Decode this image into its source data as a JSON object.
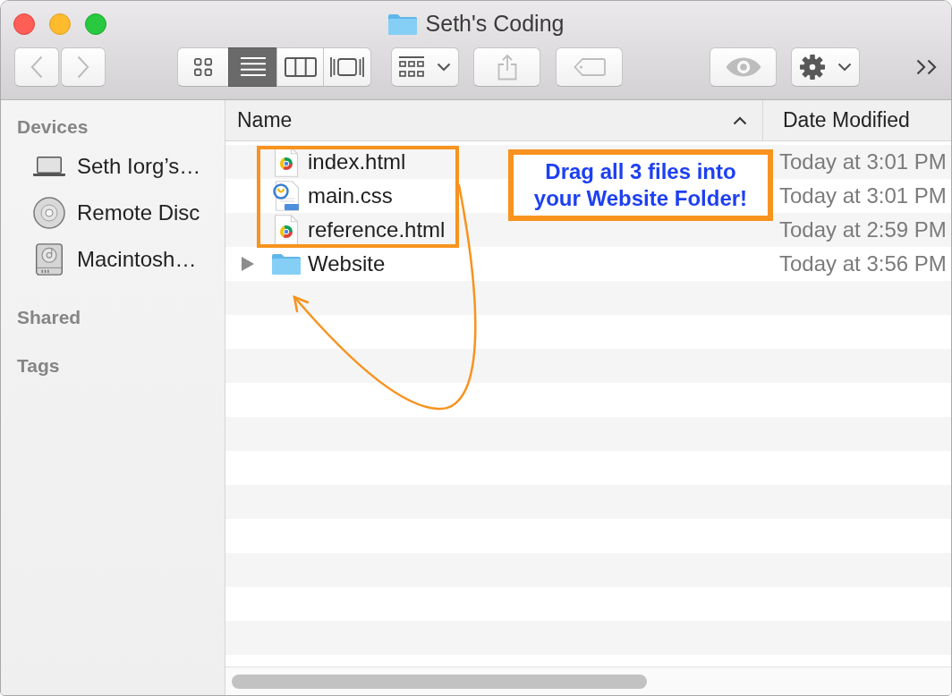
{
  "window": {
    "title": "Seth's Coding"
  },
  "toolbar": {
    "navigation": [
      {
        "kind": "back",
        "disabled": true
      },
      {
        "kind": "forward",
        "disabled": true
      }
    ],
    "view_modes": [
      {
        "kind": "icons",
        "selected": false
      },
      {
        "kind": "list",
        "selected": true
      },
      {
        "kind": "columns",
        "selected": false
      },
      {
        "kind": "gallery",
        "selected": false
      }
    ],
    "actions": [
      {
        "kind": "arrange",
        "disabled": false
      },
      {
        "kind": "share",
        "disabled": true
      },
      {
        "kind": "tags",
        "disabled": true
      },
      {
        "kind": "quick-look",
        "disabled": true
      },
      {
        "kind": "action-menu",
        "disabled": false
      }
    ]
  },
  "sidebar": {
    "sections": [
      {
        "title": "Devices",
        "items": [
          {
            "kind": "laptop",
            "label": "Seth Iorg’s…"
          },
          {
            "kind": "disc",
            "label": "Remote Disc"
          },
          {
            "kind": "drive",
            "label": "Macintosh…"
          }
        ]
      },
      {
        "title": "Shared"
      },
      {
        "title": "Tags"
      }
    ]
  },
  "file_list": {
    "columns": [
      {
        "label": "Name",
        "sorted": true
      },
      {
        "label": "Date Modified",
        "sorted": false
      }
    ],
    "rows": [
      {
        "kind": "web-page",
        "name": "index.html",
        "modified": "Today at 3:01 PM"
      },
      {
        "kind": "stylesheet",
        "name": "main.css",
        "modified": "Today at 3:01 PM"
      },
      {
        "kind": "web-page",
        "name": "reference.html",
        "modified": "Today at 2:59 PM"
      },
      {
        "kind": "folder",
        "name": "Website",
        "modified": "Today at 3:56 PM",
        "expanded": false
      }
    ]
  },
  "annotation": {
    "callout": "Drag all 3 files into your Website Folder!"
  }
}
